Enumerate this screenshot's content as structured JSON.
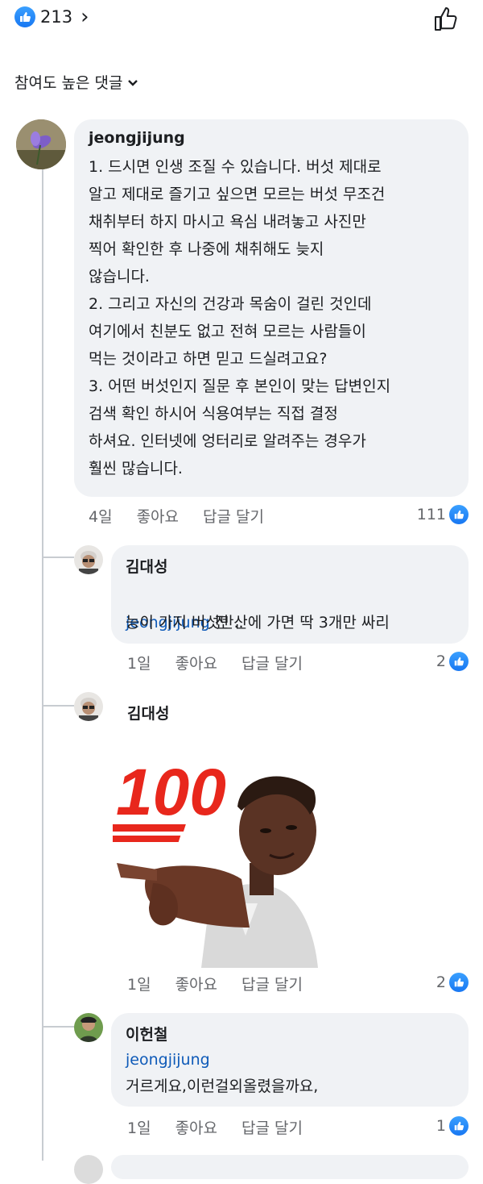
{
  "post": {
    "like_count": "213"
  },
  "sort": {
    "label": "참여도 높은 댓글"
  },
  "comments": [
    {
      "author": "jeongjijung",
      "lines": "1. 드시면 인생 조질 수 있습니다. 버섯 제대로\n알고 제대로 즐기고 싶으면 모르는 버섯 무조건\n채취부터 하지 마시고 욕심 내려놓고 사진만\n찍어 확인한 후 나중에 채취해도 늦지\n않습니다.\n2. 그리고 자신의 건강과 목숨이 걸린 것인데\n여기에서 친분도 없고 전혀 모르는 사람들이\n먹는 것이라고 하면 믿고 드실려고요?\n3. 어떤 버섯인지 질문 후 본인이 맞는 답변인지\n검색 확인 하시어 식용여부는 직접 결정\n하셔요. 인터넷에 엉터리로 알려주는 경우가\n훨씬 많습니다.",
      "time": "4일",
      "like_label": "좋아요",
      "reply_label": "답글 달기",
      "reactions": "111"
    },
    {
      "author": "김대성",
      "mention": "jeongjijung",
      "text_first": " 전 산에 가면 딱 3개만 싸리",
      "text_second": "능이 가지 버섯만..",
      "time": "1일",
      "like_label": "좋아요",
      "reply_label": "답글 달기",
      "reactions": "2"
    },
    {
      "author": "김대성",
      "sticker": "100-emoji-avatar-sticker",
      "sticker_text": "100",
      "time": "1일",
      "like_label": "좋아요",
      "reply_label": "답글 달기",
      "reactions": "2"
    },
    {
      "author": "이헌철",
      "mention": "jeongjijung",
      "text": "거르게요,이런걸외올렸을까요,",
      "time": "1일",
      "like_label": "좋아요",
      "reply_label": "답글 달기",
      "reactions": "1"
    }
  ],
  "colors": {
    "accent": "#1877f2",
    "bubble": "#f0f2f5",
    "mention": "#0e5ab8",
    "sticker_red": "#e8271c"
  },
  "icons": [
    "like-thumb-icon",
    "chevron-right-icon",
    "chevron-down-icon",
    "thumbs-up-outline-icon"
  ]
}
